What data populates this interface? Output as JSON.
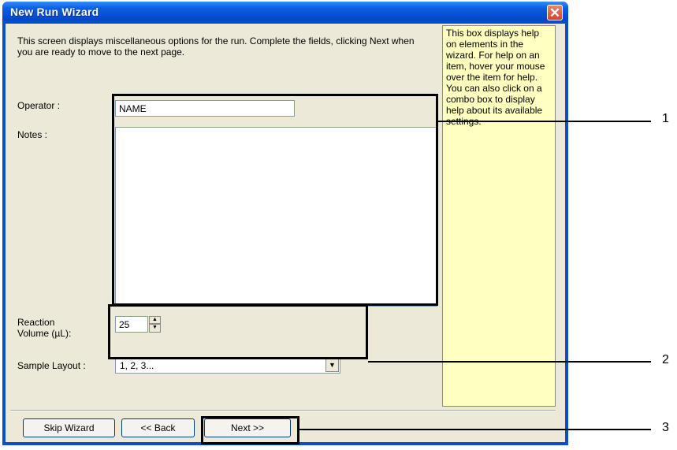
{
  "window": {
    "title": "New Run Wizard",
    "close_symbol": "✕"
  },
  "intro_text": "This screen displays miscellaneous options for the run. Complete the fields, clicking Next when you are ready to move to the next page.",
  "help_box": {
    "text": "This box displays help on elements in the wizard. For help on an item, hover your mouse over the item for help. You can also click on a combo box to display help about its available settings."
  },
  "form": {
    "operator_label": "Operator :",
    "operator_value": "NAME",
    "notes_label": "Notes :",
    "notes_value": "",
    "reaction_volume_label_1": "Reaction",
    "reaction_volume_label_2": "Volume (µL):",
    "reaction_volume_value": "25",
    "spin_up": "▲",
    "spin_down": "▼",
    "sample_layout_label": "Sample Layout :",
    "sample_layout_value": "1, 2, 3...",
    "dropdown_arrow": "▼"
  },
  "buttons": {
    "skip": "Skip Wizard",
    "back": "<< Back",
    "next": "Next >>"
  },
  "callouts": [
    "1",
    "2",
    "3"
  ]
}
